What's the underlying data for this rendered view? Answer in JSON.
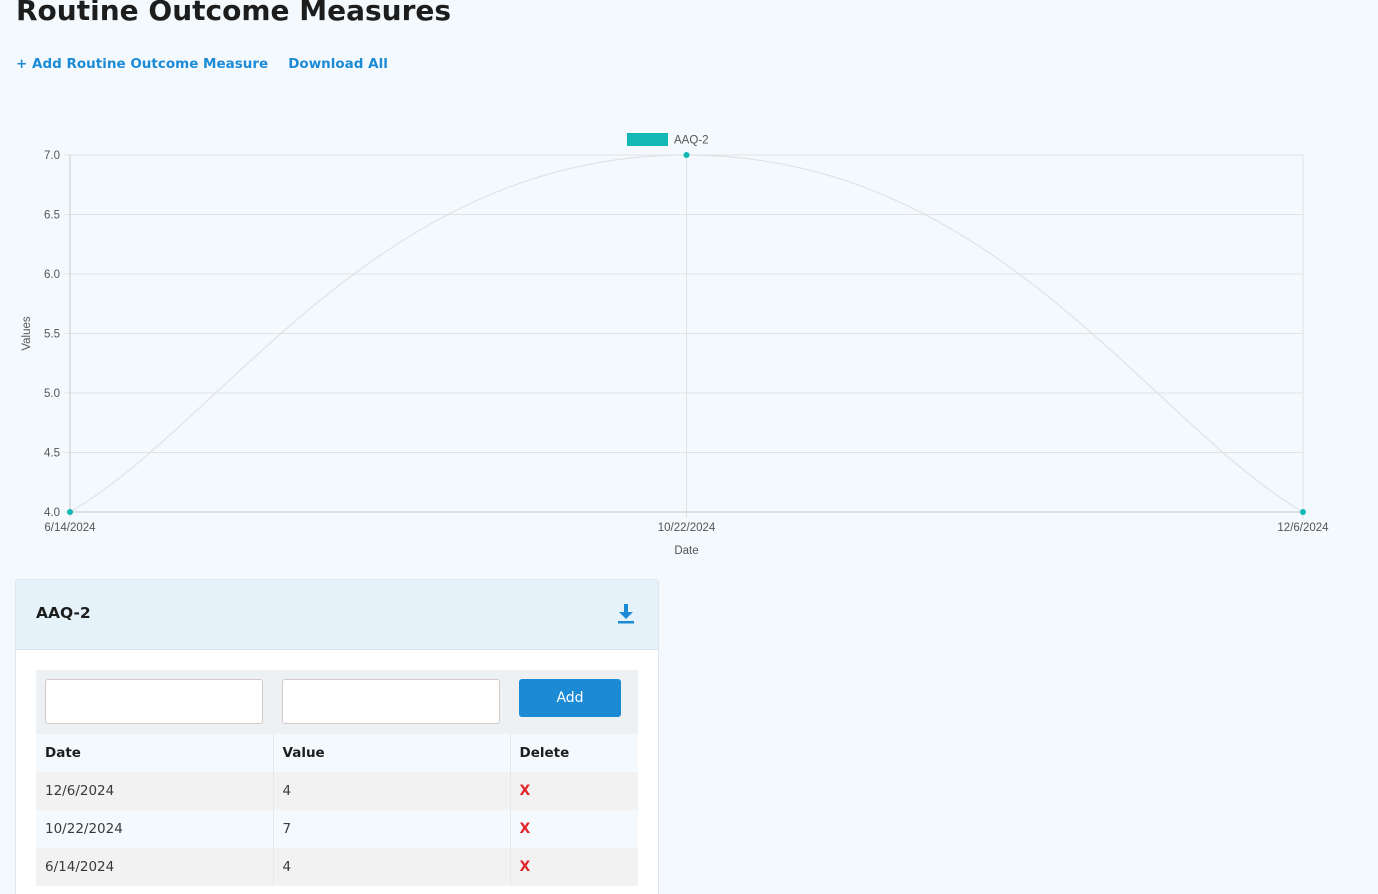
{
  "page": {
    "title": "Routine Outcome Measures"
  },
  "actions": {
    "add_label": "+ Add Routine Outcome Measure",
    "download_all_label": "Download All"
  },
  "chart_data": {
    "type": "line",
    "title": "",
    "xlabel": "Date",
    "ylabel": "Values",
    "x": [
      "6/14/2024",
      "10/22/2024",
      "12/6/2024"
    ],
    "series": [
      {
        "name": "AAQ-2",
        "values": [
          4,
          7,
          4
        ],
        "color": "#12b8b3"
      }
    ],
    "ylim": [
      4.0,
      7.0
    ],
    "yticks": [
      "4.0",
      "4.5",
      "5.0",
      "5.5",
      "6.0",
      "6.5",
      "7.0"
    ],
    "grid": true,
    "legend": "top-center"
  },
  "card": {
    "title": "AAQ-2",
    "date_placeholder": "",
    "value_placeholder": "",
    "add_label": "Add",
    "columns": [
      "Date",
      "Value",
      "Delete"
    ],
    "rows": [
      {
        "date": "12/6/2024",
        "value": "4",
        "delete": "X"
      },
      {
        "date": "10/22/2024",
        "value": "7",
        "delete": "X"
      },
      {
        "date": "6/14/2024",
        "value": "4",
        "delete": "X"
      }
    ]
  },
  "colors": {
    "accent": "#1c8bd6",
    "delete": "#e0262b",
    "series": "#12b8b3"
  },
  "icons": {
    "download": "download-icon"
  }
}
